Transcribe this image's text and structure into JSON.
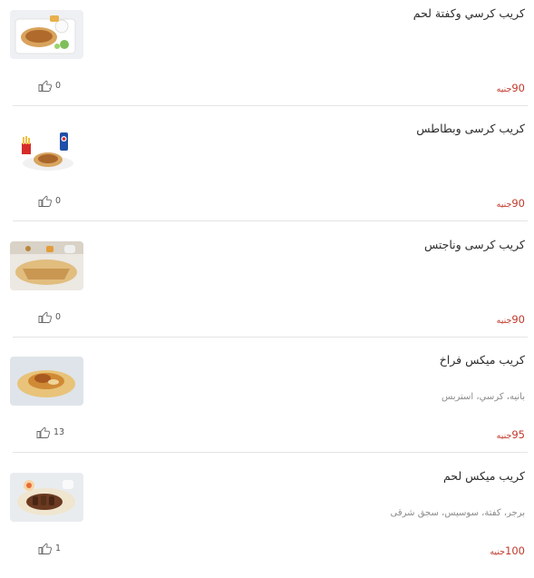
{
  "currency": "جنيه",
  "items": [
    {
      "title": "كريب كرسي وكفتة لحم",
      "description": "",
      "price": "90",
      "likes": "0",
      "image_icon": "crepe-kofta-plate-image"
    },
    {
      "title": "كريب كرسى وبطاطس",
      "description": "",
      "price": "90",
      "likes": "0",
      "image_icon": "crepe-fries-soda-image"
    },
    {
      "title": "كريب كرسى وناجتس",
      "description": "",
      "price": "90",
      "likes": "0",
      "image_icon": "crepe-nuggets-board-image"
    },
    {
      "title": "كريب ميكس فراخ",
      "description": "بانيه، كرسي، استربس",
      "price": "95",
      "likes": "13",
      "image_icon": "crepe-chicken-mix-image"
    },
    {
      "title": "كريب ميكس لحم",
      "description": "برجر، كفتة، سوسيس، سجق شرقى",
      "price": "100",
      "likes": "1",
      "image_icon": "crepe-meat-mix-image"
    }
  ],
  "like_icon": "thumbs-up-icon",
  "colors": {
    "price": "#c0392b",
    "title": "#2b2b2b",
    "description": "#8c8c8c",
    "divider": "#e4e4e4"
  }
}
